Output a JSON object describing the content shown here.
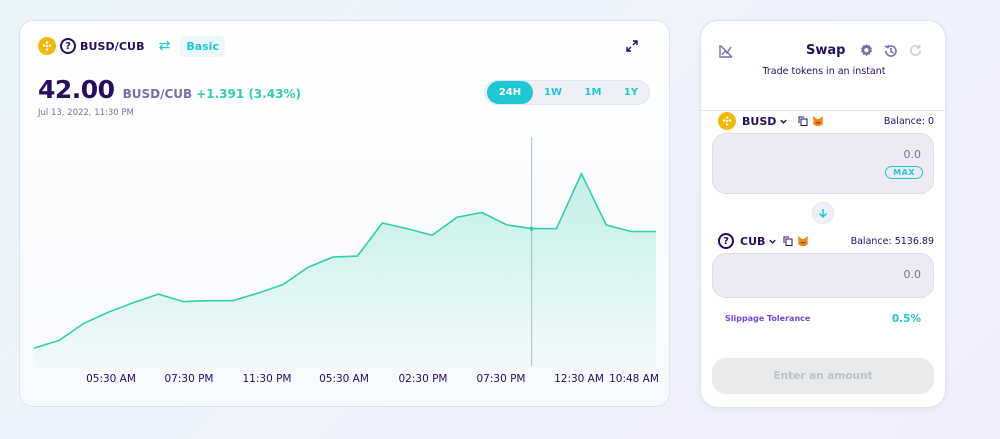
{
  "chart_panel": {
    "pair_label": "BUSD/CUB",
    "mode_label": "Basic",
    "price": "42.00",
    "price_pair": "BUSD/CUB",
    "change": "+1.391 (3.43%)",
    "timestamp": "Jul 13, 2022, 11:30 PM",
    "range_tabs": [
      {
        "label": "24H",
        "active": true
      },
      {
        "label": "1W",
        "active": false
      },
      {
        "label": "1M",
        "active": false
      },
      {
        "label": "1Y",
        "active": false
      }
    ],
    "icons": [
      "busd-coin-icon",
      "help-icon",
      "swap-arrows-icon",
      "expand-icon"
    ]
  },
  "chart_data": {
    "type": "area",
    "x_tick_labels": [
      "05:30 AM",
      "07:30 PM",
      "11:30 PM",
      "05:30 AM",
      "02:30 PM",
      "07:30 PM",
      "12:30 AM",
      "10:48 AM"
    ],
    "values": [
      35.55,
      35.95,
      36.85,
      37.45,
      37.95,
      38.4,
      38.0,
      38.05,
      38.05,
      38.45,
      38.9,
      39.8,
      40.35,
      40.4,
      42.15,
      41.85,
      41.5,
      42.45,
      42.7,
      42.05,
      41.85,
      41.85,
      44.75,
      42.05,
      41.7,
      41.7
    ],
    "highlight_index": 20,
    "ylim": [
      34.5,
      47.0
    ],
    "line_color": "#31d0aa",
    "grid": false
  },
  "swap_panel": {
    "title": "Swap",
    "subtitle": "Trade tokens in an instant",
    "from": {
      "symbol": "BUSD",
      "balance": "Balance: 0",
      "amount": "0.0",
      "max_label": "MAX"
    },
    "to": {
      "symbol": "CUB",
      "balance": "Balance: 5136.89",
      "amount": "0.0"
    },
    "slippage_label": "Slippage Tolerance",
    "slippage_value": "0.5%",
    "submit_label": "Enter an amount",
    "icons": [
      "chart-toggle-icon",
      "gear-icon",
      "history-icon",
      "refresh-icon",
      "chevron-down-icon",
      "copy-icon",
      "metamask-icon",
      "arrow-down-icon"
    ]
  },
  "colors": {
    "accent": "#1fc7d4",
    "text": "#280d5f",
    "secondary": "#7a6eaa",
    "positive": "#31d0aa"
  }
}
